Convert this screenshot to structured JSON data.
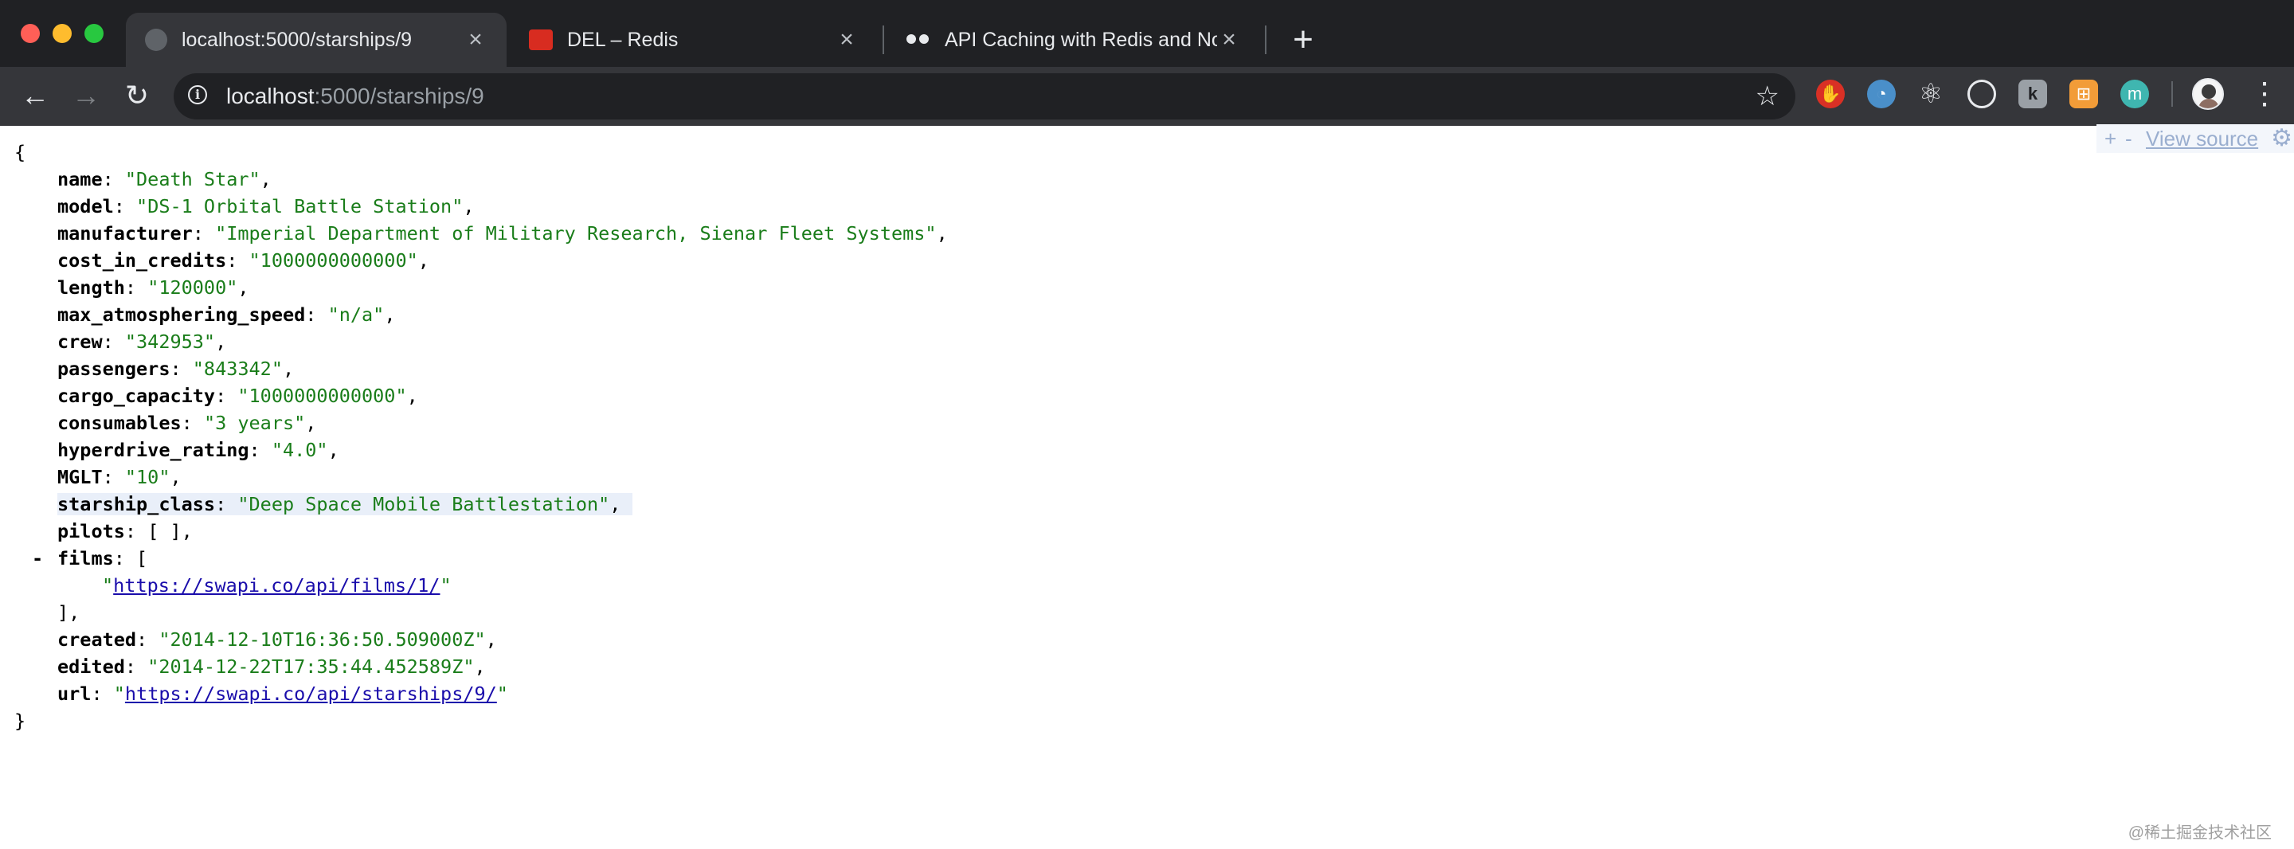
{
  "browser": {
    "tabs": [
      {
        "title": "localhost:5000/starships/9",
        "icon": "globe-icon",
        "active": true
      },
      {
        "title": "DEL – Redis",
        "icon": "redis-icon",
        "active": false
      },
      {
        "title": "API Caching with Redis and No",
        "icon": "owl-icon",
        "active": false
      }
    ],
    "url_host": "localhost",
    "url_rest": ":5000/starships/9",
    "extensions": {
      "stop": "✋",
      "drop": "◔",
      "react": "⚛",
      "ring": "◎",
      "k": "k",
      "g": "⊞",
      "m": "m"
    }
  },
  "json_view": {
    "open_brace": "{",
    "close_brace": "}",
    "fields": {
      "name": {
        "key": "name",
        "value": "\"Death Star\""
      },
      "model": {
        "key": "model",
        "value": "\"DS-1 Orbital Battle Station\""
      },
      "manufacturer": {
        "key": "manufacturer",
        "value": "\"Imperial Department of Military Research, Sienar Fleet Systems\""
      },
      "cost_in_credits": {
        "key": "cost_in_credits",
        "value": "\"1000000000000\""
      },
      "length": {
        "key": "length",
        "value": "\"120000\""
      },
      "max_atmosphering_speed": {
        "key": "max_atmosphering_speed",
        "value": "\"n/a\""
      },
      "crew": {
        "key": "crew",
        "value": "\"342953\""
      },
      "passengers": {
        "key": "passengers",
        "value": "\"843342\""
      },
      "cargo_capacity": {
        "key": "cargo_capacity",
        "value": "\"1000000000000\""
      },
      "consumables": {
        "key": "consumables",
        "value": "\"3 years\""
      },
      "hyperdrive_rating": {
        "key": "hyperdrive_rating",
        "value": "\"4.0\""
      },
      "MGLT": {
        "key": "MGLT",
        "value": "\"10\""
      },
      "starship_class": {
        "key": "starship_class",
        "value": "\"Deep Space Mobile Battlestation\""
      },
      "pilots": {
        "key": "pilots",
        "value": "[ ]"
      },
      "films": {
        "key": "films",
        "open": "[",
        "close": "],",
        "toggle": "-",
        "items": [
          {
            "url": "https://swapi.co/api/films/1/"
          }
        ]
      },
      "created": {
        "key": "created",
        "value": "\"2014-12-10T16:36:50.509000Z\""
      },
      "edited": {
        "key": "edited",
        "value": "\"2014-12-22T17:35:44.452589Z\""
      },
      "url": {
        "key": "url",
        "link": "https://swapi.co/api/starships/9/"
      }
    }
  },
  "view_source": {
    "plus": "+",
    "minus": "-",
    "label": "View source",
    "gear": "⚙"
  },
  "watermark": "@稀土掘金技术社区"
}
